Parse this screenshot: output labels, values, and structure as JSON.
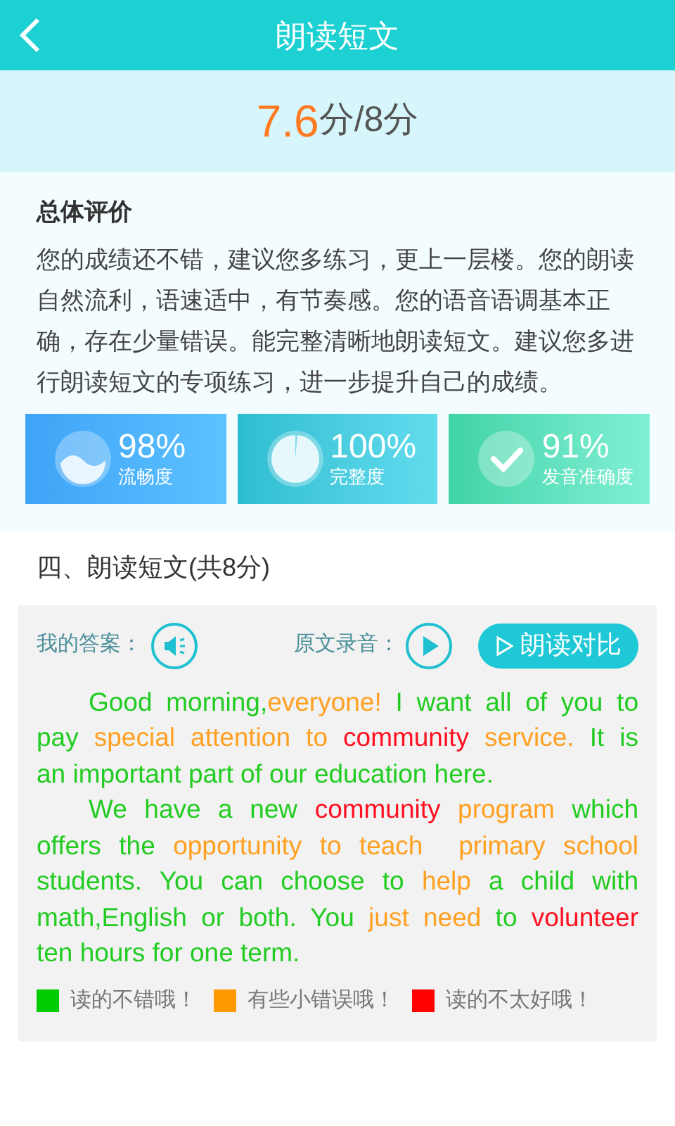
{
  "header": {
    "title": "朗读短文"
  },
  "score": {
    "value": "7.6",
    "unit": "分/8分"
  },
  "evaluation": {
    "title": "总体评价",
    "text": "您的成绩还不错，建议您多练习，更上一层楼。您的朗读自然流利，语速适中，有节奏感。您的语音语调基本正确，存在少量错误。能完整清晰地朗读短文。建议您多进行朗读短文的专项练习，进一步提升自己的成绩。"
  },
  "metrics": [
    {
      "kind": "fluency",
      "value": "98%",
      "label": "流畅度"
    },
    {
      "kind": "completeness",
      "value": "100%",
      "label": "完整度"
    },
    {
      "kind": "accuracy",
      "value": "91%",
      "label": "发音准确度"
    }
  ],
  "section_title": "四、朗读短文(共8分)",
  "answer": {
    "my_answer_label": "我的答案：",
    "original_label": "原文录音：",
    "compare_button": "朗读对比"
  },
  "passage": [
    {
      "kind": "first",
      "segments": [
        {
          "text": "Good morning,",
          "color": "#22cc22"
        },
        {
          "text": "everyone!",
          "color": "#ffa020"
        },
        {
          "text": " I want all of you to",
          "color": "#22cc22"
        }
      ]
    },
    {
      "kind": "middle",
      "segments": [
        {
          "text": "pay ",
          "color": "#22cc22"
        },
        {
          "text": "special attention to",
          "color": "#ffa020"
        },
        {
          "text": " community",
          "color": "#ff1020"
        },
        {
          "text": " service.",
          "color": "#ffa020"
        },
        {
          "text": " It is",
          "color": "#22cc22"
        }
      ]
    },
    {
      "kind": "last",
      "segments": [
        {
          "text": "an important part of our education here.",
          "color": "#22cc22"
        }
      ]
    },
    {
      "kind": "first",
      "segments": [
        {
          "text": "We have a new ",
          "color": "#22cc22"
        },
        {
          "text": "community",
          "color": "#ff1020"
        },
        {
          "text": " program",
          "color": "#ffa020"
        },
        {
          "text": " which",
          "color": "#22cc22"
        }
      ]
    },
    {
      "kind": "middle",
      "segments": [
        {
          "text": "offers the ",
          "color": "#22cc22"
        },
        {
          "text": "opportunity to teach  primary school",
          "color": "#ffa020"
        }
      ]
    },
    {
      "kind": "middle",
      "segments": [
        {
          "text": "students. You can choose to ",
          "color": "#22cc22"
        },
        {
          "text": "help",
          "color": "#ffa020"
        },
        {
          "text": " a child with",
          "color": "#22cc22"
        }
      ]
    },
    {
      "kind": "middle",
      "segments": [
        {
          "text": "math,English or both. You ",
          "color": "#22cc22"
        },
        {
          "text": "just need",
          "color": "#ffa020"
        },
        {
          "text": " to ",
          "color": "#22cc22"
        },
        {
          "text": "volunteer",
          "color": "#ff1020"
        }
      ]
    },
    {
      "kind": "last",
      "segments": [
        {
          "text": "ten hours for one term.",
          "color": "#22cc22"
        }
      ]
    }
  ],
  "legend": [
    {
      "label": "读的不错哦！",
      "color": "#00cc00"
    },
    {
      "label": "有些小错误哦！",
      "color": "#ff9900"
    },
    {
      "label": "读的不太好哦！",
      "color": "#ff0000"
    }
  ]
}
